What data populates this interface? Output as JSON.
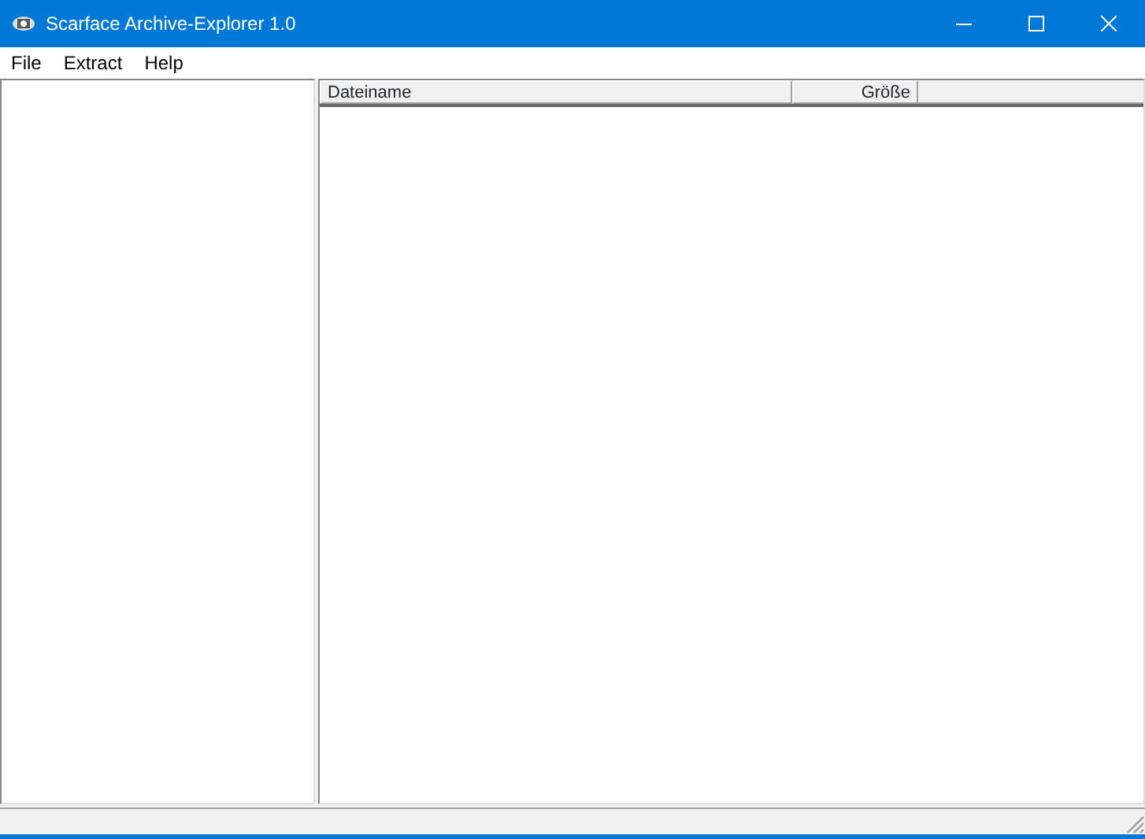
{
  "window": {
    "title": "Scarface Archive-Explorer 1.0"
  },
  "menu": [
    "File",
    "Extract",
    "Help"
  ],
  "file_list": {
    "columns": [
      "Dateiname",
      "Größe"
    ]
  }
}
